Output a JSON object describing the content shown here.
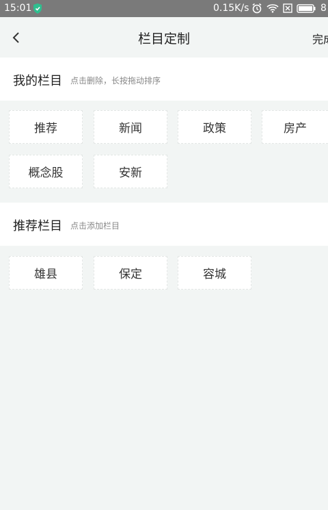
{
  "status_bar": {
    "time": "15:01",
    "net_speed": "0.15K/s",
    "battery": "8"
  },
  "header": {
    "title": "栏目定制",
    "done_label": "完成"
  },
  "my_section": {
    "title": "我的栏目",
    "hint": "点击删除，长按拖动排序",
    "items": [
      "推荐",
      "新闻",
      "政策",
      "房产",
      "概念股",
      "安新"
    ]
  },
  "recommend_section": {
    "title": "推荐栏目",
    "hint": "点击添加栏目",
    "items": [
      "雄县",
      "保定",
      "容城"
    ]
  },
  "colors": {
    "background": "#f2f5f4",
    "status_bar": "#7a7a7a",
    "card": "#ffffff",
    "shield_icon": "#2fbf8f"
  },
  "icons": [
    "shield-icon",
    "alarm-icon",
    "wifi-icon",
    "sim-card-icon",
    "battery-icon",
    "back-arrow-icon"
  ]
}
